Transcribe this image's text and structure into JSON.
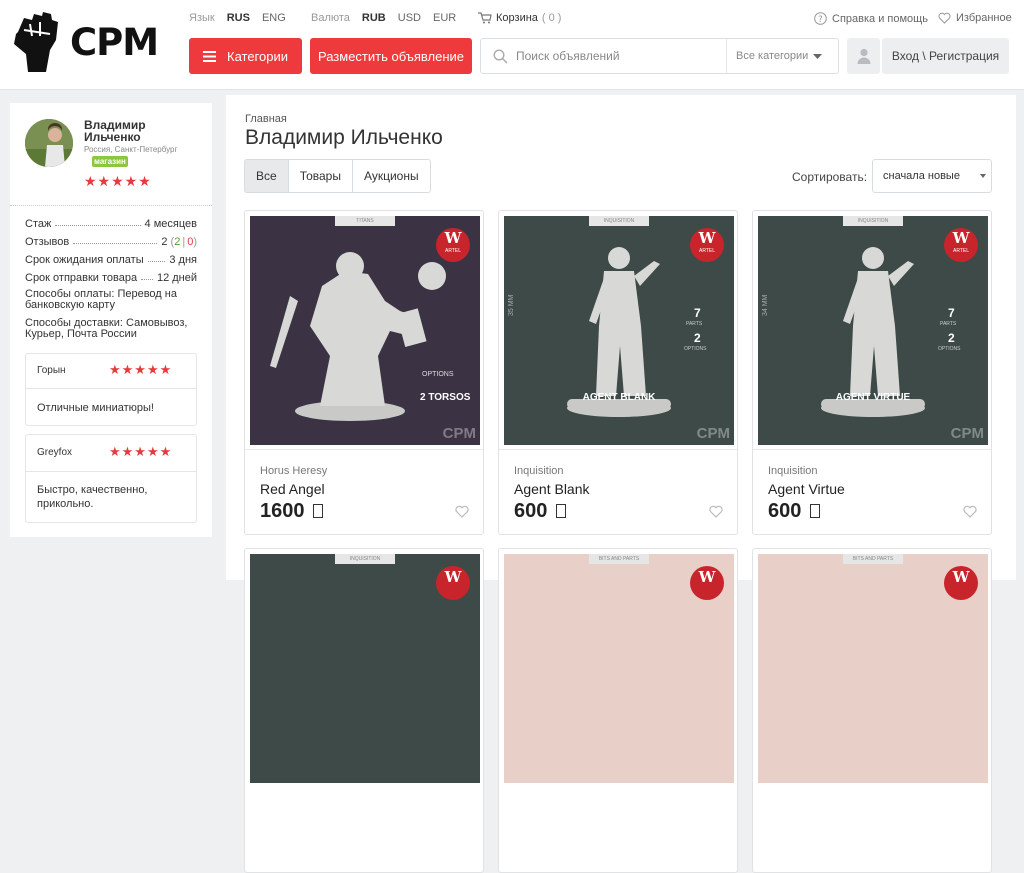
{
  "header": {
    "logo_text": "CPM",
    "language_label": "Язык",
    "languages": [
      "RUS",
      "ENG"
    ],
    "currency_label": "Валюта",
    "currencies": [
      "RUB",
      "USD",
      "EUR"
    ],
    "cart_label": "Корзина",
    "cart_count": "( 0 )",
    "help_label": "Справка и помощь",
    "favorites_label": "Избранное",
    "categories_button": "Категории",
    "post_ad_button": "Разместить объявление",
    "search_placeholder": "Поиск объявлений",
    "search_category": "Все категории",
    "login_label": "Вход \\ Регистрация"
  },
  "seller": {
    "name": "Владимир Ильченко",
    "location": "Россия, Санкт-Петербург",
    "badge": "магазин",
    "stars": "★★★★★",
    "stats": [
      {
        "label": "Стаж",
        "value": "4 месяцев"
      },
      {
        "label": "Отзывов",
        "value": "2",
        "pos": "2",
        "neg": "0"
      },
      {
        "label": "Срок ожидания оплаты",
        "value": "3 дня"
      },
      {
        "label": "Срок отправки товара",
        "value": "12 дней"
      }
    ],
    "payment": "Способы оплаты: Перевод на банковскую карту",
    "delivery": "Способы доставки: Самовывоз, Курьер, Почта России",
    "reviews": [
      {
        "author": "Горын",
        "stars": "★★★★★",
        "text": "Отличные миниатюры!"
      },
      {
        "author": "Greyfox",
        "stars": "★★★★★",
        "text": "Быстро, качественно, прикольно."
      }
    ]
  },
  "main": {
    "breadcrumb": "Главная",
    "title": "Владимир Ильченко",
    "tabs": [
      "Все",
      "Товары",
      "Аукционы"
    ],
    "sort_label": "Сортировать:",
    "sort_value": "сначала новые",
    "products": [
      {
        "category": "Horus Heresy",
        "name": "Red Angel",
        "price": "1600",
        "img_tag": "TITANS",
        "img_caption": "2 TORSOS",
        "img_sub": "OPTIONS",
        "color": "#3b3343"
      },
      {
        "category": "Inquisition",
        "name": "Agent Blank",
        "price": "600",
        "img_tag": "INQUISITION",
        "img_caption": "AGENT BLANK",
        "parts": "7",
        "options": "2",
        "height": "35 MM",
        "color": "#3d4a47"
      },
      {
        "category": "Inquisition",
        "name": "Agent Virtue",
        "price": "600",
        "img_tag": "INQUISITION",
        "img_caption": "AGENT VIRTUE",
        "parts": "7",
        "options": "2",
        "height": "34 MM",
        "color": "#3d4a47"
      }
    ],
    "bottom_tags": [
      "INQUISITION",
      "BITS AND PARTS",
      "BITS AND PARTS"
    ],
    "watermark": "CPM",
    "brand_badge": "W",
    "brand_sub": "ARTEL",
    "parts_label": "PARTS",
    "options_label": "OPTIONS"
  },
  "colors": {
    "accent": "#ee3a3d",
    "card_dark": "#3d4a47",
    "card_purple": "#3b3343",
    "card_pink": "#e8cfc7"
  }
}
